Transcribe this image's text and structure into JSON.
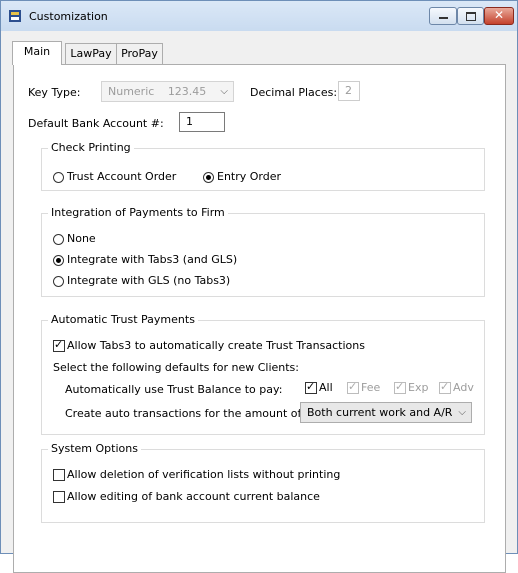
{
  "window": {
    "title": "Customization"
  },
  "tabs": [
    "Main",
    "LawPay",
    "ProPay"
  ],
  "key_type": {
    "label": "Key Type:",
    "value": "Numeric",
    "sample": "123.45"
  },
  "decimal_places": {
    "label": "Decimal Places:",
    "value": "2"
  },
  "default_bank": {
    "label": "Default Bank Account #:",
    "value": "1"
  },
  "check_printing": {
    "title": "Check Printing",
    "options": [
      "Trust Account Order",
      "Entry Order"
    ],
    "selected": "Entry Order"
  },
  "integration": {
    "title": "Integration of Payments to Firm",
    "options": [
      "None",
      "Integrate with Tabs3 (and GLS)",
      "Integrate with GLS (no Tabs3)"
    ],
    "selected": "Integrate with Tabs3 (and GLS)"
  },
  "auto_trust": {
    "title": "Automatic Trust Payments",
    "allow_label": "Allow Tabs3 to automatically create Trust Transactions",
    "allow_checked": true,
    "defaults_label": "Select the following defaults for new Clients:",
    "use_balance_label": "Automatically use Trust Balance to pay:",
    "pay_options": [
      {
        "label": "All",
        "checked": true,
        "enabled": true
      },
      {
        "label": "Fee",
        "checked": true,
        "enabled": false
      },
      {
        "label": "Exp",
        "checked": true,
        "enabled": false
      },
      {
        "label": "Adv",
        "checked": true,
        "enabled": false
      }
    ],
    "amount_label": "Create auto transactions for the amount of:",
    "amount_value": "Both current work and A/R"
  },
  "system_options": {
    "title": "System Options",
    "options": [
      {
        "label": "Allow deletion of verification lists without printing",
        "checked": false
      },
      {
        "label": "Allow editing of bank account current balance",
        "checked": false
      }
    ]
  }
}
